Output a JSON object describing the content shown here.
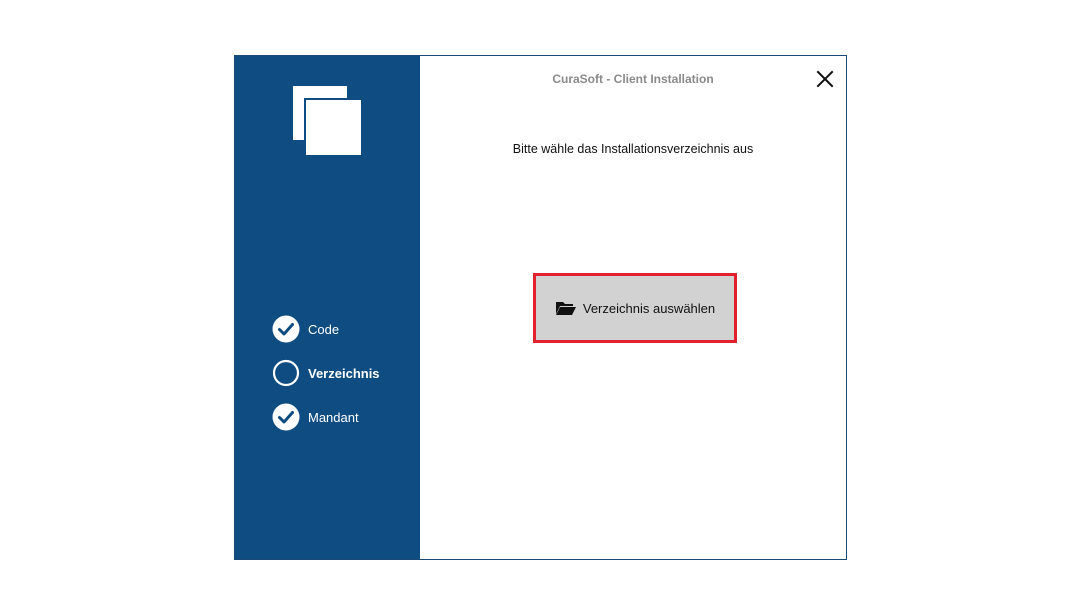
{
  "window": {
    "title": "CuraSoft - Client Installation",
    "close_icon": "close-icon"
  },
  "sidebar": {
    "logo_icon": "overlapping-squares-logo",
    "steps": [
      {
        "label": "Code",
        "state": "done",
        "icon": "checkmark-circle-icon"
      },
      {
        "label": "Verzeichnis",
        "state": "current",
        "icon": "circle-outline-icon"
      },
      {
        "label": "Mandant",
        "state": "done",
        "icon": "checkmark-circle-icon"
      }
    ]
  },
  "main": {
    "prompt": "Bitte wähle das Installationsverzeichnis aus",
    "choose_button": {
      "label": "Verzeichnis auswählen",
      "icon": "folder-open-icon"
    }
  },
  "colors": {
    "sidebar_bg": "#0f4c81",
    "button_bg": "#d2d2d2",
    "highlight_border": "#e3202d",
    "title_text": "#8a8a8a"
  }
}
